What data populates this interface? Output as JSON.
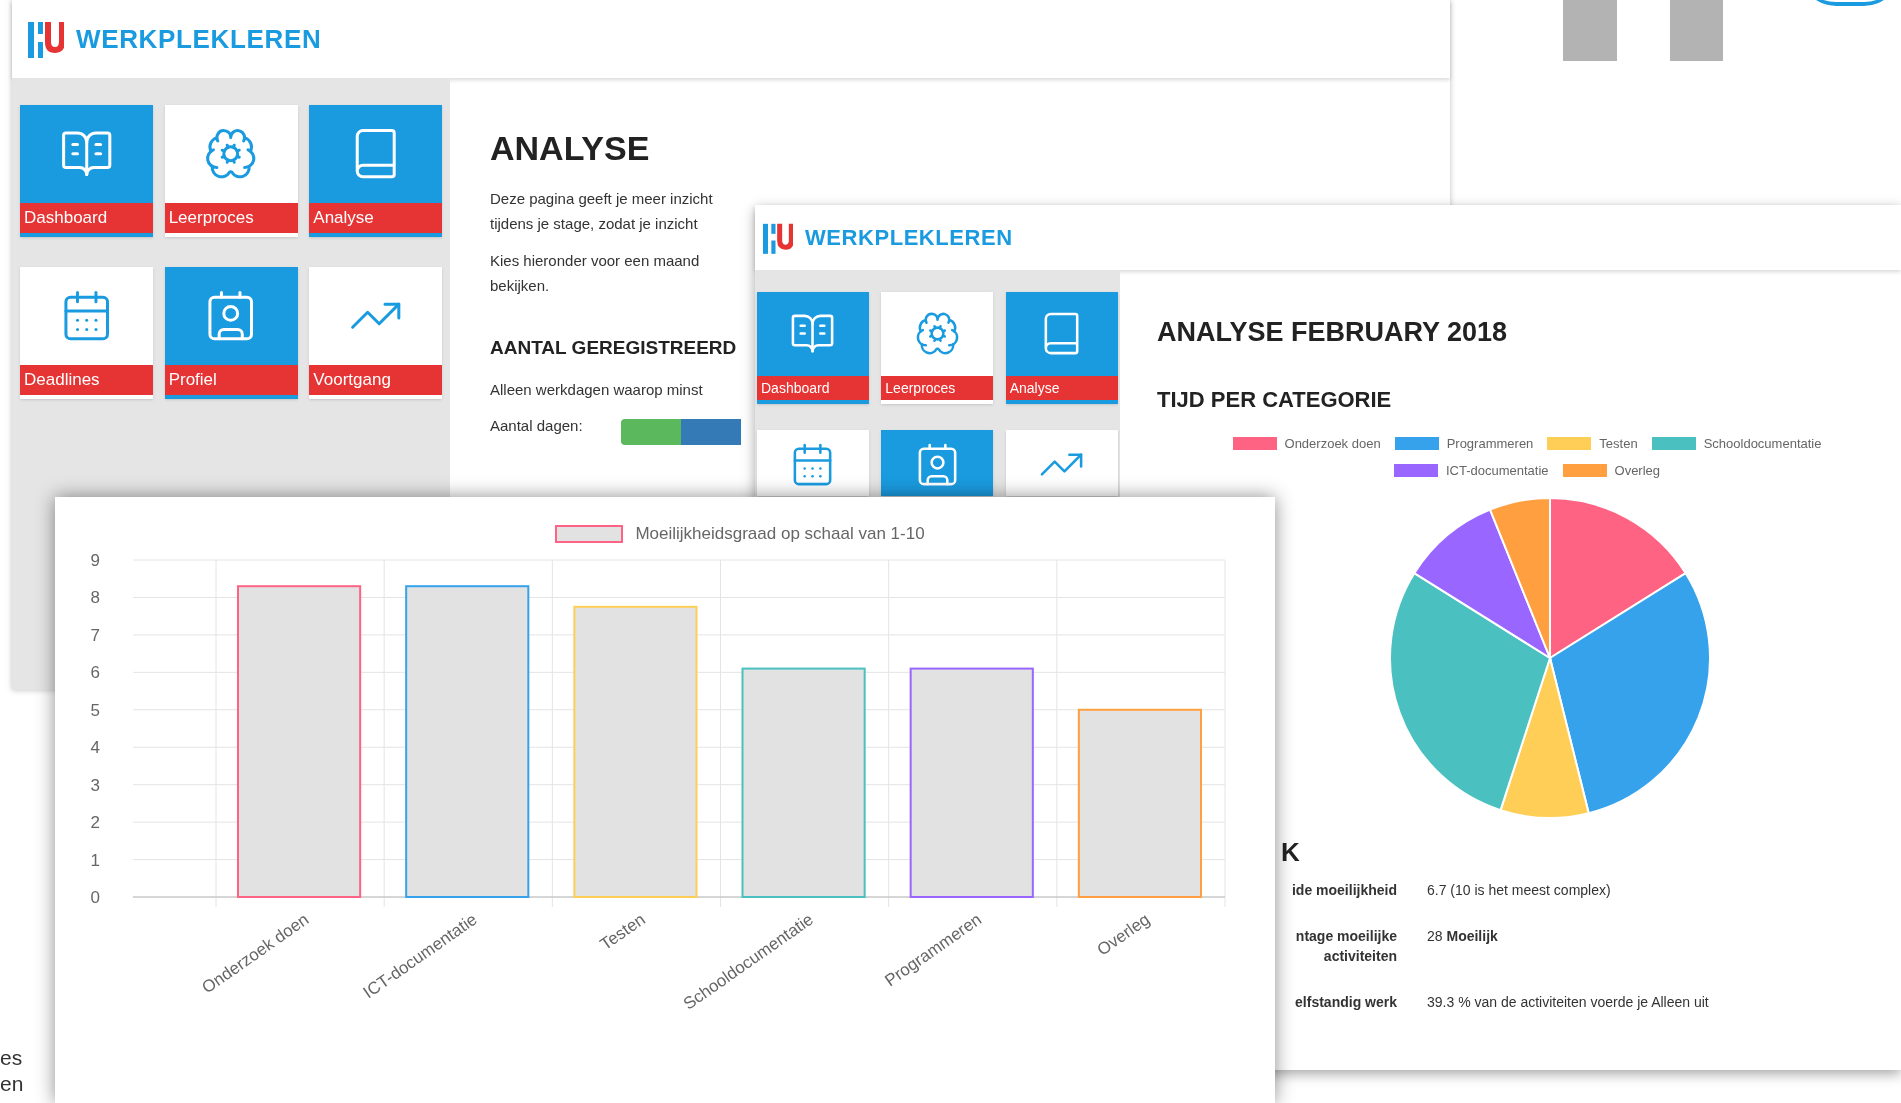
{
  "back_window": {
    "brand": "WERKPLEKLEREN",
    "tiles": [
      {
        "label": "Dashboard",
        "filled": true
      },
      {
        "label": "Leerproces",
        "filled": false
      },
      {
        "label": "Analyse",
        "filled": true
      },
      {
        "label": "Deadlines",
        "filled": false
      },
      {
        "label": "Profiel",
        "filled": true
      },
      {
        "label": "Voortgang",
        "filled": false
      }
    ],
    "title": "ANALYSE",
    "intro_lines": [
      "Deze pagina geeft je meer inzicht",
      "tijdens je stage, zodat je inzicht"
    ],
    "choose_lines": [
      "Kies hieronder voor een maand",
      "bekijken."
    ],
    "section_heading": "AANTAL GEREGISTREERD",
    "note": "Alleen werkdagen waarop minst",
    "days_label": "Aantal dagen:",
    "days_bar": {
      "segments": [
        {
          "color": "#5cb85c"
        },
        {
          "color": "#337ab7"
        }
      ]
    }
  },
  "middle_window": {
    "brand": "WERKPLEKLEREN",
    "tiles": [
      {
        "label": "Dashboard",
        "filled": true
      },
      {
        "label": "Leerproces",
        "filled": false
      },
      {
        "label": "Analyse",
        "filled": true
      },
      {
        "filled": false
      },
      {
        "filled": true
      },
      {
        "filled": false
      }
    ],
    "title": "ANALYSE FEBRUARY 2018",
    "subtitle": "TIJD PER CATEGORIE",
    "pie_legend": [
      {
        "label": "Onderzoek doen",
        "color": "#ff6384"
      },
      {
        "label": "Programmeren",
        "color": "#36a2eb"
      },
      {
        "label": "Testen",
        "color": "#ffce56"
      },
      {
        "label": "Schooldocumentatie",
        "color": "#4bc0c0"
      },
      {
        "label": "ICT-documentatie",
        "color": "#9966ff"
      },
      {
        "label": "Overleg",
        "color": "#ff9f40"
      }
    ],
    "stats_heading": "K",
    "stats": [
      {
        "label_lines": [
          "ide moeilijkheid"
        ],
        "value": "6.7 (10 is het meest complex)"
      },
      {
        "label_lines": [
          "ntage moeilijke",
          "activiteiten"
        ],
        "value": "28 **Moeilijk**"
      },
      {
        "label_lines": [
          "elfstandig werk"
        ],
        "value": "39.3 % van de activiteiten voerde je Alleen uit"
      }
    ]
  },
  "front_window": {
    "chart_data": {
      "type": "bar",
      "categories": [
        "Onderzoek doen",
        "ICT-documentatie",
        "Testen",
        "Schooldocumentatie",
        "Programmeren",
        "Overleg"
      ],
      "series": [
        {
          "name": "Moeilijkheidsgraad op schaal van 1-10",
          "color": "#e2e2e2",
          "values": [
            8.3,
            8.3,
            7.75,
            6.1,
            6.1,
            5.0
          ]
        }
      ],
      "ylim": [
        0,
        9
      ],
      "grid": true,
      "yticks": [
        0,
        1,
        2,
        3,
        4,
        5,
        6,
        7,
        8,
        9
      ]
    },
    "bar_outlines": [
      {
        "color": "#ff6384"
      },
      {
        "color": "#36a2eb"
      },
      {
        "color": "#ffce56"
      },
      {
        "color": "#4bc0c0"
      },
      {
        "color": "#9966ff"
      },
      {
        "color": "#ff9f40"
      }
    ]
  },
  "background_fragments": [
    "es",
    "en"
  ]
}
